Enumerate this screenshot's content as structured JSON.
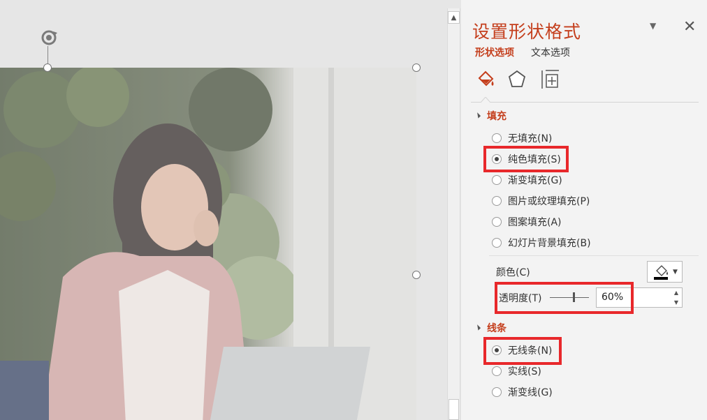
{
  "pane": {
    "title": "设置形状格式",
    "tabs": [
      {
        "label": "形状选项",
        "active": true
      },
      {
        "label": "文本选项",
        "active": false
      }
    ],
    "dropdown_icon": "caret-down-icon",
    "close_icon": "close-icon",
    "category_icons": [
      "fill-line-icon",
      "effects-pentagon-icon",
      "size-properties-icon"
    ]
  },
  "fill": {
    "heading": "填充",
    "options": [
      {
        "label": "无填充(N)",
        "selected": false
      },
      {
        "label": "纯色填充(S)",
        "selected": true
      },
      {
        "label": "渐变填充(G)",
        "selected": false
      },
      {
        "label": "图片或纹理填充(P)",
        "selected": false
      },
      {
        "label": "图案填充(A)",
        "selected": false
      },
      {
        "label": "幻灯片背景填充(B)",
        "selected": false
      }
    ],
    "color_label": "颜色(C)",
    "color_value": "#000000",
    "transparency_label": "透明度(T)",
    "transparency_value": "60%",
    "transparency_fraction": 0.6
  },
  "line": {
    "heading": "线条",
    "options": [
      {
        "label": "无线条(N)",
        "selected": true
      },
      {
        "label": "实线(S)",
        "selected": false
      },
      {
        "label": "渐变线(G)",
        "selected": false
      }
    ]
  },
  "colors": {
    "accent": "#c43e1c",
    "highlight_box": "#e8282b",
    "pane_background": "#f3f3f3",
    "canvas_background": "#e6e6e6"
  }
}
